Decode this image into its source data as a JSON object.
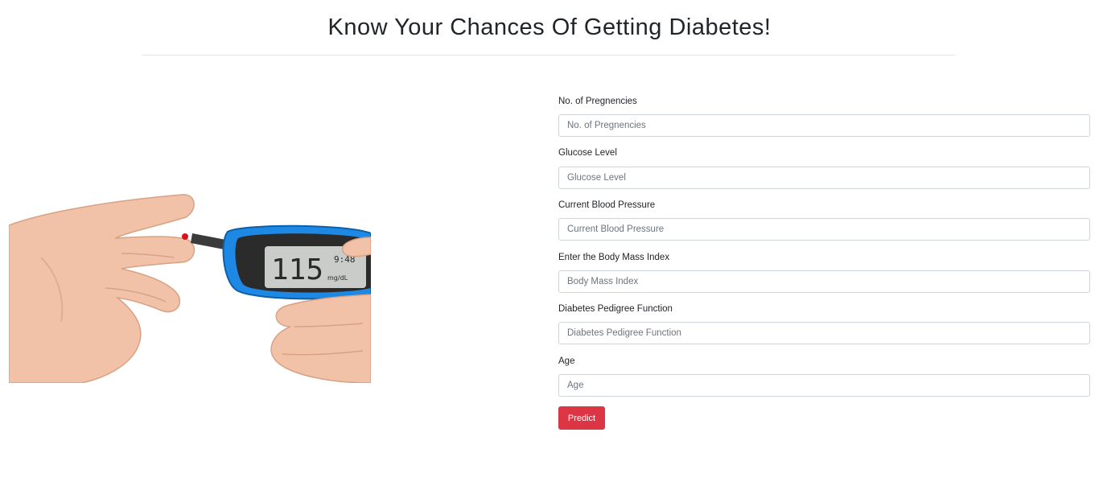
{
  "page": {
    "title": "Know Your Chances Of Getting Diabetes!"
  },
  "illustration": {
    "meter_reading": "115",
    "meter_time": "9:48",
    "meter_unit": "mg/dL"
  },
  "form": {
    "fields": [
      {
        "label": "No. of Pregnencies",
        "placeholder": "No. of Pregnencies",
        "value": ""
      },
      {
        "label": "Glucose Level",
        "placeholder": "Glucose Level",
        "value": ""
      },
      {
        "label": "Current Blood Pressure",
        "placeholder": "Current Blood Pressure",
        "value": ""
      },
      {
        "label": "Enter the Body Mass Index",
        "placeholder": "Body Mass Index",
        "value": ""
      },
      {
        "label": "Diabetes Pedigree Function",
        "placeholder": "Diabetes Pedigree Function",
        "value": ""
      },
      {
        "label": "Age",
        "placeholder": "Age",
        "value": ""
      }
    ],
    "predict_label": "Predict"
  },
  "colors": {
    "button": "#dc3545",
    "meter_body": "#1e88e5",
    "skin": "#f2c2a8"
  }
}
